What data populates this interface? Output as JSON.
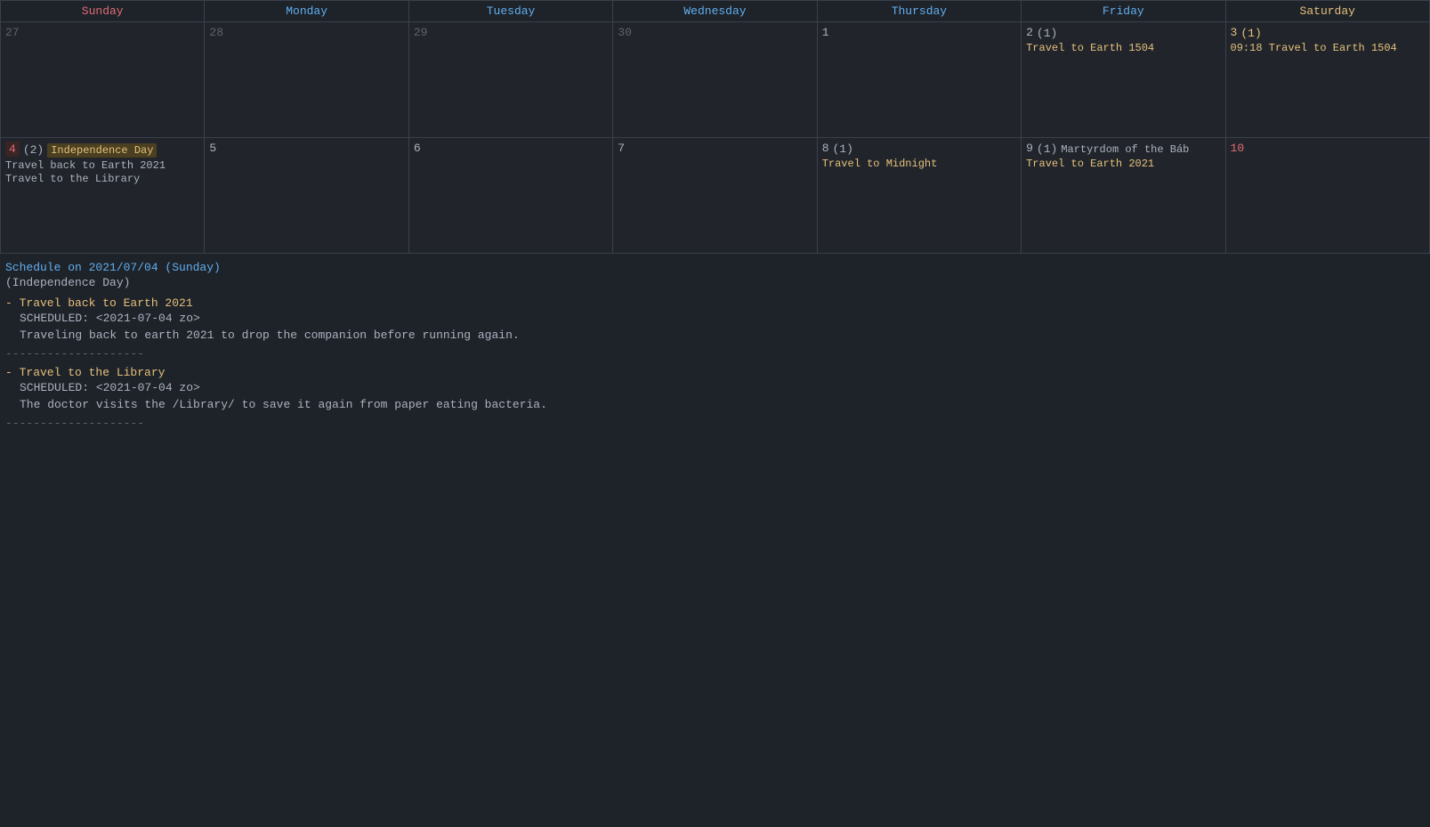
{
  "calendar": {
    "headers": [
      {
        "label": "Sunday",
        "class": "sun"
      },
      {
        "label": "Monday",
        "class": "mon"
      },
      {
        "label": "Tuesday",
        "class": "tue"
      },
      {
        "label": "Wednesday",
        "class": "wed"
      },
      {
        "label": "Thursday",
        "class": "thu"
      },
      {
        "label": "Friday",
        "class": "fri"
      },
      {
        "label": "Saturday",
        "class": "sat"
      }
    ],
    "weeks": [
      [
        {
          "day": "27",
          "type": "other-month",
          "events": []
        },
        {
          "day": "28",
          "type": "other-month",
          "events": []
        },
        {
          "day": "29",
          "type": "other-month",
          "events": []
        },
        {
          "day": "30",
          "type": "other-month",
          "events": []
        },
        {
          "day": "1",
          "type": "normal",
          "events": []
        },
        {
          "day": "2",
          "type": "normal",
          "count": "(1)",
          "count_color": "normal",
          "events": [
            {
              "text": "Travel to Earth 1504",
              "color": "orange"
            }
          ]
        },
        {
          "day": "3",
          "type": "normal",
          "count": "(1)",
          "count_color": "orange",
          "day_color": "orange",
          "events": [
            {
              "text": "09:18 Travel to Earth 1504",
              "color": "orange"
            }
          ]
        }
      ],
      [
        {
          "day": "4",
          "type": "highlight",
          "count": "(2)",
          "count_color": "normal",
          "badge": "Independence Day",
          "events": [
            {
              "text": "Travel back to Earth 2021",
              "color": "normal"
            },
            {
              "text": "Travel to the Library",
              "color": "normal"
            }
          ]
        },
        {
          "day": "5",
          "type": "normal",
          "events": []
        },
        {
          "day": "6",
          "type": "normal",
          "events": []
        },
        {
          "day": "7",
          "type": "normal",
          "events": []
        },
        {
          "day": "8",
          "type": "normal",
          "count": "(1)",
          "count_color": "normal",
          "events": [
            {
              "text": "Travel to Midnight",
              "color": "orange"
            }
          ]
        },
        {
          "day": "9",
          "type": "normal",
          "count": "(1)",
          "count_color": "normal",
          "badge": "Martyrdom of the Báb",
          "events": [
            {
              "text": "Travel to Earth 2021",
              "color": "orange"
            }
          ]
        },
        {
          "day": "10",
          "type": "normal",
          "day_color": "red-plain",
          "events": []
        }
      ]
    ]
  },
  "schedule": {
    "title": "Schedule on 2021/07/04 (Sunday)",
    "subtitle": "(Independence Day)",
    "entries": [
      {
        "title": "- Travel back to Earth 2021",
        "scheduled": "SCHEDULED: <2021-07-04 zo>",
        "desc": "Traveling back to earth 2021 to drop the companion before running again."
      },
      {
        "title": "- Travel to the Library",
        "scheduled": "SCHEDULED: <2021-07-04 zo>",
        "desc": "The doctor visits the /Library/ to save it again from paper eating bacteria."
      }
    ],
    "divider": "--------------------"
  }
}
